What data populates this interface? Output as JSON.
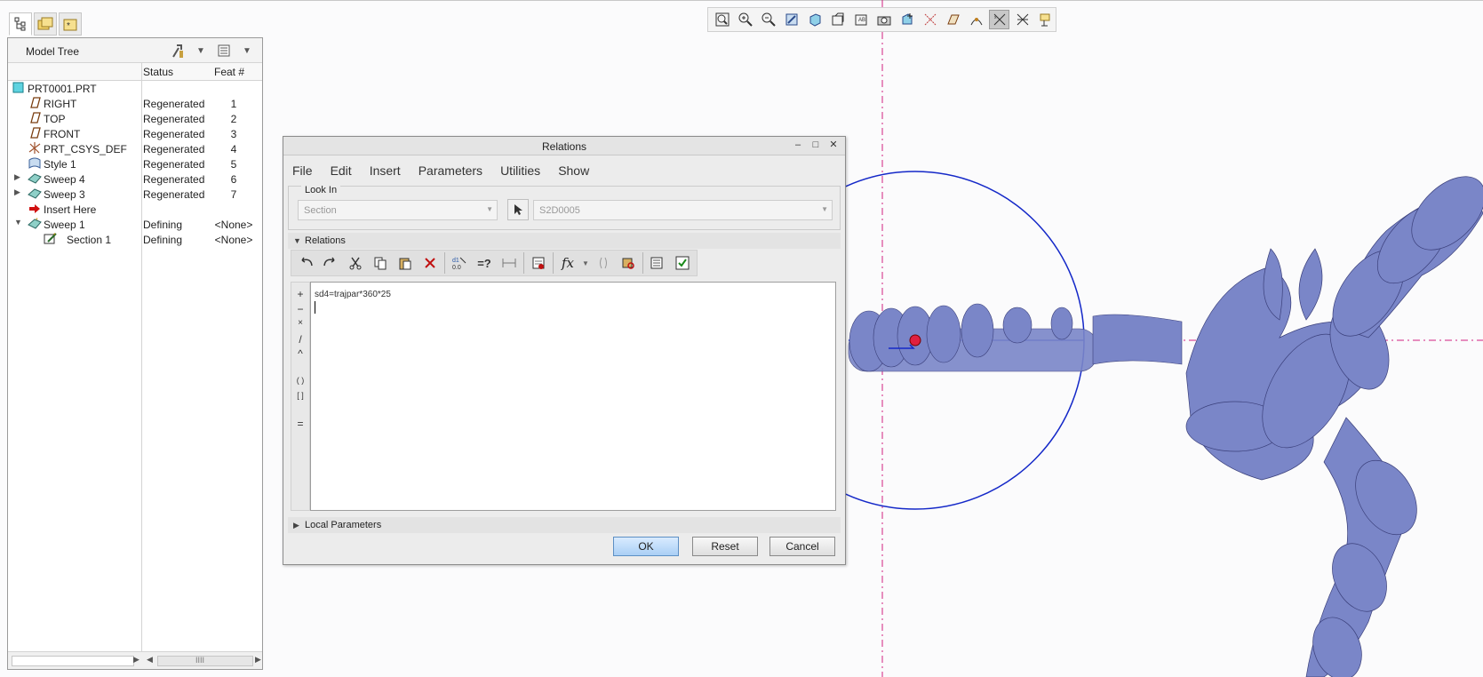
{
  "model_tree": {
    "title": "Model Tree",
    "columns": {
      "status": "Status",
      "feat": "Feat #"
    },
    "items": [
      {
        "name": "PRT0001.PRT",
        "status": "",
        "feat": ""
      },
      {
        "name": "RIGHT",
        "status": "Regenerated",
        "feat": "1"
      },
      {
        "name": "TOP",
        "status": "Regenerated",
        "feat": "2"
      },
      {
        "name": "FRONT",
        "status": "Regenerated",
        "feat": "3"
      },
      {
        "name": "PRT_CSYS_DEF",
        "status": "Regenerated",
        "feat": "4"
      },
      {
        "name": "Style 1",
        "status": "Regenerated",
        "feat": "5"
      },
      {
        "name": "Sweep 4",
        "status": "Regenerated",
        "feat": "6"
      },
      {
        "name": "Sweep 3",
        "status": "Regenerated",
        "feat": "7"
      },
      {
        "name": "Insert Here",
        "status": "",
        "feat": ""
      },
      {
        "name": "Sweep 1",
        "status": "Defining",
        "feat": "<None>"
      },
      {
        "name": "Section 1",
        "status": "Defining",
        "feat": "<None>"
      }
    ]
  },
  "relations_dialog": {
    "title": "Relations",
    "menu": [
      "File",
      "Edit",
      "Insert",
      "Parameters",
      "Utilities",
      "Show"
    ],
    "look_in": {
      "label": "Look In",
      "type_value": "Section",
      "item_value": "S2D0005"
    },
    "relations_section": "Relations",
    "relation_text": "sd4=trajpar*360*25",
    "operators": [
      "+",
      "−",
      "×",
      "/",
      "^",
      "( )",
      "[ ]",
      "="
    ],
    "local_parameters": "Local Parameters",
    "buttons": {
      "ok": "OK",
      "reset": "Reset",
      "cancel": "Cancel"
    },
    "toolbar_fx": "fx",
    "toolbar_eq": "=?"
  },
  "scroll_marker": "IIII",
  "colors": {
    "geometry": "#7a86c8",
    "sketch_blue": "#1428c8",
    "datum_pink": "#d02080",
    "ok_button": "#a9cff5"
  }
}
